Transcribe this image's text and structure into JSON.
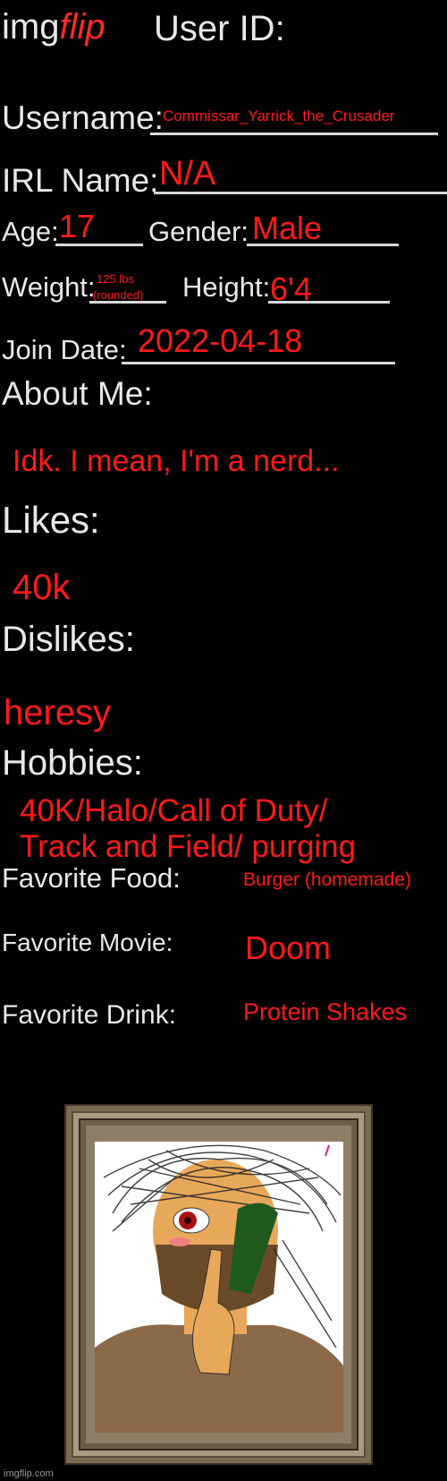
{
  "header": {
    "logo_img": "img",
    "logo_flip": "flip",
    "title": "User ID:"
  },
  "labels": {
    "username": "Username:",
    "irl_name": "IRL Name:",
    "age": "Age:",
    "gender": "Gender:",
    "weight": "Weight:",
    "height": "Height:",
    "join_date": "Join Date:",
    "about_me": "About Me:",
    "likes": "Likes:",
    "dislikes": "Dislikes:",
    "hobbies": "Hobbies:",
    "favorite_food": "Favorite Food:",
    "favorite_movie": "Favorite Movie:",
    "favorite_drink": "Favorite Drink:"
  },
  "values": {
    "username": "Commissar_Yarrick_the_Crusader",
    "irl_name": "N/A",
    "age": "17",
    "gender": "Male",
    "weight_line1": "125 lbs",
    "weight_line2": "(rounded)",
    "height": "6'4",
    "join_date": "2022-04-18",
    "about_me": "Idk. I mean, I'm a nerd...",
    "likes": "40k",
    "dislikes": "heresy",
    "hobbies_line1": "40K/Halo/Call of Duty/",
    "hobbies_line2": "Track and Field/ purging",
    "favorite_food": "Burger (homemade)",
    "favorite_movie": "Doom",
    "favorite_drink": "Protein Shakes"
  },
  "footer": {
    "watermark": "imgflip.com"
  },
  "colors": {
    "label": "#e8e8e8",
    "value": "#ff1a1a",
    "background": "#000000"
  }
}
